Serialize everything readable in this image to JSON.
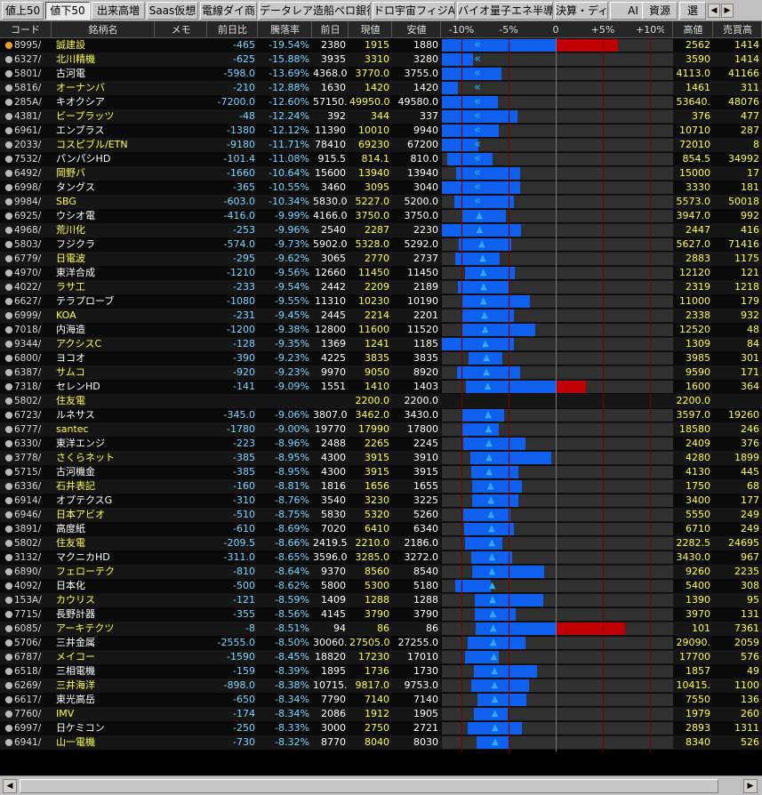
{
  "tabs": [
    "値上50",
    "値下50",
    "出来高増",
    "Saas仮想",
    "電線ダイ商",
    "データレア造船ペロ銀行",
    "ドロ宇宙フィジAI",
    "バイオ量子エネ半導",
    "決算・ディ",
    "AI",
    "資源",
    "選"
  ],
  "active_tab": 1,
  "columns": [
    "コード",
    "銘柄名",
    "メモ",
    "前日比",
    "騰落率",
    "前日",
    "現値",
    "安値",
    "",
    "高値",
    "売買高"
  ],
  "chart_ticks": [
    "-10%",
    "-5%",
    "0",
    "+5%",
    "+10%"
  ],
  "colors": {
    "bar_negative": "#1060f0",
    "bar_positive": "#c00000",
    "name_yellow": "#ffff40",
    "code_color": "#d8d8d8",
    "triangle": "#2ab0ff"
  },
  "rows": [
    {
      "code": "8995/",
      "name": "誠建設",
      "yellow": true,
      "chg": "-465",
      "pct": "-19.54%",
      "prev": "2380",
      "price": "1915",
      "low": "1880",
      "high": "2562",
      "vol": "1414",
      "pct_val": -19.54,
      "vs_low": -21.0,
      "vs_high": 6.6,
      "marker": "double-chevron"
    },
    {
      "code": "6327/",
      "name": "北川精機",
      "yellow": true,
      "chg": "-625",
      "pct": "-15.88%",
      "prev": "3935",
      "price": "3310",
      "low": "3280",
      "high": "3590",
      "vol": "1414",
      "pct_val": -15.88,
      "vs_low": -16.6,
      "vs_high": -8.8,
      "marker": "double-chevron"
    },
    {
      "code": "5801/",
      "name": "古河電",
      "yellow": false,
      "chg": "-598.0",
      "pct": "-13.69%",
      "prev": "4368.0",
      "price": "3770.0",
      "low": "3755.0",
      "high": "4113.0",
      "vol": "41166",
      "pct_val": -13.69,
      "vs_low": -14.0,
      "vs_high": -5.8,
      "marker": "double-chevron"
    },
    {
      "code": "5816/",
      "name": "オーナンバ",
      "yellow": true,
      "chg": "-210",
      "pct": "-12.88%",
      "prev": "1630",
      "price": "1420",
      "low": "1420",
      "high": "1461",
      "vol": "311",
      "pct_val": -12.88,
      "vs_low": -12.9,
      "vs_high": -10.4,
      "marker": "double-chevron"
    },
    {
      "code": "285A/",
      "name": "キオクシア",
      "yellow": false,
      "chg": "-7200.0",
      "pct": "-12.60%",
      "prev": "57150.",
      "price": "49950.0",
      "low": "49580.0",
      "high": "53640.",
      "vol": "48076",
      "pct_val": -12.6,
      "vs_low": -13.2,
      "vs_high": -6.1,
      "marker": "double-chevron"
    },
    {
      "code": "4381/",
      "name": "ビープラッツ",
      "yellow": true,
      "chg": "-48",
      "pct": "-12.24%",
      "prev": "392",
      "price": "344",
      "low": "337",
      "high": "376",
      "vol": "477",
      "pct_val": -12.24,
      "vs_low": -14.0,
      "vs_high": -4.1,
      "marker": "double-chevron"
    },
    {
      "code": "6961/",
      "name": "エンプラス",
      "yellow": false,
      "chg": "-1380",
      "pct": "-12.12%",
      "prev": "11390",
      "price": "10010",
      "low": "9940",
      "high": "10710",
      "vol": "287",
      "pct_val": -12.12,
      "vs_low": -12.7,
      "vs_high": -6.0,
      "marker": "double-chevron"
    },
    {
      "code": "2033/",
      "name": "コスピブル/ETN",
      "yellow": true,
      "chg": "-9180",
      "pct": "-11.71%",
      "prev": "78410",
      "price": "69230",
      "low": "67200",
      "high": "72010",
      "vol": "8",
      "pct_val": -11.71,
      "vs_low": -14.3,
      "vs_high": -8.2,
      "marker": "double-chevron"
    },
    {
      "code": "7532/",
      "name": "パンパシHD",
      "yellow": false,
      "chg": "-101.4",
      "pct": "-11.08%",
      "prev": "915.5",
      "price": "814.1",
      "low": "810.0",
      "high": "854.5",
      "vol": "34992",
      "pct_val": -11.08,
      "vs_low": -11.5,
      "vs_high": -6.7,
      "marker": "double-chevron"
    },
    {
      "code": "6492/",
      "name": "岡野バ",
      "yellow": true,
      "chg": "-1660",
      "pct": "-10.64%",
      "prev": "15600",
      "price": "13940",
      "low": "13940",
      "high": "15000",
      "vol": "17",
      "pct_val": -10.64,
      "vs_low": -10.6,
      "vs_high": -3.8,
      "marker": "double-chevron"
    },
    {
      "code": "6998/",
      "name": "タングス",
      "yellow": false,
      "chg": "-365",
      "pct": "-10.55%",
      "prev": "3460",
      "price": "3095",
      "low": "3040",
      "high": "3330",
      "vol": "181",
      "pct_val": -10.55,
      "vs_low": -12.1,
      "vs_high": -3.8,
      "marker": "double-chevron"
    },
    {
      "code": "9984/",
      "name": "SBG",
      "yellow": true,
      "chg": "-603.0",
      "pct": "-10.34%",
      "prev": "5830.0",
      "price": "5227.0",
      "low": "5200.0",
      "high": "5573.0",
      "vol": "50018",
      "pct_val": -10.34,
      "vs_low": -10.8,
      "vs_high": -4.4,
      "marker": "double-chevron"
    },
    {
      "code": "6925/",
      "name": "ウシオ電",
      "yellow": false,
      "chg": "-416.0",
      "pct": "-9.99%",
      "prev": "4166.0",
      "price": "3750.0",
      "low": "3750.0",
      "high": "3947.0",
      "vol": "992",
      "pct_val": -9.99,
      "vs_low": -10.0,
      "vs_high": -5.3,
      "marker": "triangle"
    },
    {
      "code": "4968/",
      "name": "荒川化",
      "yellow": true,
      "chg": "-253",
      "pct": "-9.96%",
      "prev": "2540",
      "price": "2287",
      "low": "2230",
      "high": "2447",
      "vol": "416",
      "pct_val": -9.96,
      "vs_low": -12.2,
      "vs_high": -3.7,
      "marker": "triangle"
    },
    {
      "code": "5803/",
      "name": "フジクラ",
      "yellow": false,
      "chg": "-574.0",
      "pct": "-9.73%",
      "prev": "5902.0",
      "price": "5328.0",
      "low": "5292.0",
      "high": "5627.0",
      "vol": "71416",
      "pct_val": -9.73,
      "vs_low": -10.3,
      "vs_high": -4.7,
      "marker": "triangle"
    },
    {
      "code": "6779/",
      "name": "日電波",
      "yellow": true,
      "chg": "-295",
      "pct": "-9.62%",
      "prev": "3065",
      "price": "2770",
      "low": "2737",
      "high": "2883",
      "vol": "1175",
      "pct_val": -9.62,
      "vs_low": -10.7,
      "vs_high": -5.9,
      "marker": "triangle"
    },
    {
      "code": "4970/",
      "name": "東洋合成",
      "yellow": false,
      "chg": "-1210",
      "pct": "-9.56%",
      "prev": "12660",
      "price": "11450",
      "low": "11450",
      "high": "12120",
      "vol": "121",
      "pct_val": -9.56,
      "vs_low": -9.6,
      "vs_high": -4.3,
      "marker": "triangle"
    },
    {
      "code": "4022/",
      "name": "ラサ工",
      "yellow": true,
      "chg": "-233",
      "pct": "-9.54%",
      "prev": "2442",
      "price": "2209",
      "low": "2189",
      "high": "2319",
      "vol": "1218",
      "pct_val": -9.54,
      "vs_low": -10.4,
      "vs_high": -5.0,
      "marker": "triangle"
    },
    {
      "code": "6627/",
      "name": "テラプローブ",
      "yellow": false,
      "chg": "-1080",
      "pct": "-9.55%",
      "prev": "11310",
      "price": "10230",
      "low": "10190",
      "high": "11000",
      "vol": "179",
      "pct_val": -9.55,
      "vs_low": -9.9,
      "vs_high": -2.7,
      "marker": "triangle"
    },
    {
      "code": "6999/",
      "name": "KOA",
      "yellow": true,
      "chg": "-231",
      "pct": "-9.45%",
      "prev": "2445",
      "price": "2214",
      "low": "2201",
      "high": "2338",
      "vol": "932",
      "pct_val": -9.45,
      "vs_low": -10.0,
      "vs_high": -4.4,
      "marker": "triangle"
    },
    {
      "code": "7018/",
      "name": "内海造",
      "yellow": false,
      "chg": "-1200",
      "pct": "-9.38%",
      "prev": "12800",
      "price": "11600",
      "low": "11520",
      "high": "12520",
      "vol": "48",
      "pct_val": -9.38,
      "vs_low": -10.0,
      "vs_high": -2.2,
      "marker": "triangle"
    },
    {
      "code": "9344/",
      "name": "アクシスC",
      "yellow": true,
      "chg": "-128",
      "pct": "-9.35%",
      "prev": "1369",
      "price": "1241",
      "low": "1185",
      "high": "1309",
      "vol": "84",
      "pct_val": -9.35,
      "vs_low": -13.4,
      "vs_high": -4.4,
      "marker": "triangle"
    },
    {
      "code": "6800/",
      "name": "ヨコオ",
      "yellow": false,
      "chg": "-390",
      "pct": "-9.23%",
      "prev": "4225",
      "price": "3835",
      "low": "3835",
      "high": "3985",
      "vol": "301",
      "pct_val": -9.23,
      "vs_low": -9.2,
      "vs_high": -5.7,
      "marker": "triangle"
    },
    {
      "code": "6387/",
      "name": "サムコ",
      "yellow": true,
      "chg": "-920",
      "pct": "-9.23%",
      "prev": "9970",
      "price": "9050",
      "low": "8920",
      "high": "9590",
      "vol": "171",
      "pct_val": -9.23,
      "vs_low": -10.5,
      "vs_high": -3.8,
      "marker": "triangle"
    },
    {
      "code": "7318/",
      "name": "セレンHD",
      "yellow": false,
      "chg": "-141",
      "pct": "-9.09%",
      "prev": "1551",
      "price": "1410",
      "low": "1403",
      "high": "1600",
      "vol": "364",
      "pct_val": -9.09,
      "vs_low": -9.5,
      "vs_high": 3.2,
      "marker": "triangle"
    },
    {
      "code": "5802/",
      "name": "住友電",
      "yellow": true,
      "chg": "",
      "pct": "",
      "prev": "",
      "price": "2200.0",
      "low": "2200.0",
      "high": "2200.0",
      "vol": "",
      "pct_val": null,
      "vs_low": null,
      "vs_high": null,
      "marker": "none"
    },
    {
      "code": "6723/",
      "name": "ルネサス",
      "yellow": false,
      "chg": "-345.0",
      "pct": "-9.06%",
      "prev": "3807.0",
      "price": "3462.0",
      "low": "3430.0",
      "high": "3597.0",
      "vol": "19260",
      "pct_val": -9.06,
      "vs_low": -9.9,
      "vs_high": -5.5,
      "marker": "triangle"
    },
    {
      "code": "6777/",
      "name": "santec",
      "yellow": true,
      "chg": "-1780",
      "pct": "-9.00%",
      "prev": "19770",
      "price": "17990",
      "low": "17800",
      "high": "18580",
      "vol": "246",
      "pct_val": -9.0,
      "vs_low": -10.0,
      "vs_high": -6.0,
      "marker": "triangle"
    },
    {
      "code": "6330/",
      "name": "東洋エンジ",
      "yellow": false,
      "chg": "-223",
      "pct": "-8.96%",
      "prev": "2488",
      "price": "2265",
      "low": "2245",
      "high": "2409",
      "vol": "376",
      "pct_val": -8.96,
      "vs_low": -9.8,
      "vs_high": -3.2,
      "marker": "triangle"
    },
    {
      "code": "3778/",
      "name": "さくらネット",
      "yellow": true,
      "chg": "-385",
      "pct": "-8.95%",
      "prev": "4300",
      "price": "3915",
      "low": "3910",
      "high": "4280",
      "vol": "1899",
      "pct_val": -8.95,
      "vs_low": -9.1,
      "vs_high": -0.5,
      "marker": "triangle"
    },
    {
      "code": "5715/",
      "name": "古河機金",
      "yellow": false,
      "chg": "-385",
      "pct": "-8.95%",
      "prev": "4300",
      "price": "3915",
      "low": "3915",
      "high": "4130",
      "vol": "445",
      "pct_val": -8.95,
      "vs_low": -9.0,
      "vs_high": -4.0,
      "marker": "triangle"
    },
    {
      "code": "6336/",
      "name": "石井表記",
      "yellow": true,
      "chg": "-160",
      "pct": "-8.81%",
      "prev": "1816",
      "price": "1656",
      "low": "1655",
      "high": "1750",
      "vol": "68",
      "pct_val": -8.81,
      "vs_low": -8.9,
      "vs_high": -3.6,
      "marker": "triangle"
    },
    {
      "code": "6914/",
      "name": "オプテクスG",
      "yellow": false,
      "chg": "-310",
      "pct": "-8.76%",
      "prev": "3540",
      "price": "3230",
      "low": "3225",
      "high": "3400",
      "vol": "177",
      "pct_val": -8.76,
      "vs_low": -8.9,
      "vs_high": -4.0,
      "marker": "triangle"
    },
    {
      "code": "6946/",
      "name": "日本アビオ",
      "yellow": true,
      "chg": "-510",
      "pct": "-8.75%",
      "prev": "5830",
      "price": "5320",
      "low": "5260",
      "high": "5550",
      "vol": "249",
      "pct_val": -8.75,
      "vs_low": -9.8,
      "vs_high": -4.8,
      "marker": "triangle"
    },
    {
      "code": "3891/",
      "name": "高度紙",
      "yellow": false,
      "chg": "-610",
      "pct": "-8.69%",
      "prev": "7020",
      "price": "6410",
      "low": "6340",
      "high": "6710",
      "vol": "249",
      "pct_val": -8.69,
      "vs_low": -9.7,
      "vs_high": -4.4,
      "marker": "triangle"
    },
    {
      "code": "5802/",
      "name": "住友電",
      "yellow": true,
      "chg": "-209.5",
      "pct": "-8.66%",
      "prev": "2419.5",
      "price": "2210.0",
      "low": "2186.0",
      "high": "2282.5",
      "vol": "24695",
      "pct_val": -8.66,
      "vs_low": -9.6,
      "vs_high": -5.7,
      "marker": "triangle"
    },
    {
      "code": "3132/",
      "name": "マクニカHD",
      "yellow": false,
      "chg": "-311.0",
      "pct": "-8.65%",
      "prev": "3596.0",
      "price": "3285.0",
      "low": "3272.0",
      "high": "3430.0",
      "vol": "967",
      "pct_val": -8.65,
      "vs_low": -9.0,
      "vs_high": -4.6,
      "marker": "triangle"
    },
    {
      "code": "6890/",
      "name": "フェローテク",
      "yellow": true,
      "chg": "-810",
      "pct": "-8.64%",
      "prev": "9370",
      "price": "8560",
      "low": "8540",
      "high": "9260",
      "vol": "2235",
      "pct_val": -8.64,
      "vs_low": -8.9,
      "vs_high": -1.2,
      "marker": "triangle"
    },
    {
      "code": "4092/",
      "name": "日本化",
      "yellow": false,
      "chg": "-500",
      "pct": "-8.62%",
      "prev": "5800",
      "price": "5300",
      "low": "5180",
      "high": "5400",
      "vol": "308",
      "pct_val": -8.62,
      "vs_low": -10.7,
      "vs_high": -6.9,
      "marker": "triangle"
    },
    {
      "code": "153A/",
      "name": "カウリス",
      "yellow": true,
      "chg": "-121",
      "pct": "-8.59%",
      "prev": "1409",
      "price": "1288",
      "low": "1288",
      "high": "1390",
      "vol": "95",
      "pct_val": -8.59,
      "vs_low": -8.6,
      "vs_high": -1.3,
      "marker": "triangle"
    },
    {
      "code": "7715/",
      "name": "長野計器",
      "yellow": false,
      "chg": "-355",
      "pct": "-8.56%",
      "prev": "4145",
      "price": "3790",
      "low": "3790",
      "high": "3970",
      "vol": "131",
      "pct_val": -8.56,
      "vs_low": -8.6,
      "vs_high": -4.2,
      "marker": "triangle"
    },
    {
      "code": "6085/",
      "name": "アーキテクツ",
      "yellow": true,
      "chg": "-8",
      "pct": "-8.51%",
      "prev": "94",
      "price": "86",
      "low": "86",
      "high": "101",
      "vol": "7361",
      "pct_val": -8.51,
      "vs_low": -8.5,
      "vs_high": 7.4,
      "marker": "triangle"
    },
    {
      "code": "5706/",
      "name": "三井金属",
      "yellow": false,
      "chg": "-2555.0",
      "pct": "-8.50%",
      "prev": "30060.",
      "price": "27505.0",
      "low": "27255.0",
      "high": "29090.",
      "vol": "2059",
      "pct_val": -8.5,
      "vs_low": -9.3,
      "vs_high": -3.2,
      "marker": "triangle"
    },
    {
      "code": "6787/",
      "name": "メイコー",
      "yellow": true,
      "chg": "-1590",
      "pct": "-8.45%",
      "prev": "18820",
      "price": "17230",
      "low": "17010",
      "high": "17700",
      "vol": "576",
      "pct_val": -8.45,
      "vs_low": -9.6,
      "vs_high": -6.0,
      "marker": "triangle"
    },
    {
      "code": "6518/",
      "name": "三相電機",
      "yellow": false,
      "chg": "-159",
      "pct": "-8.39%",
      "prev": "1895",
      "price": "1736",
      "low": "1730",
      "high": "1857",
      "vol": "49",
      "pct_val": -8.39,
      "vs_low": -8.7,
      "vs_high": -2.0,
      "marker": "triangle"
    },
    {
      "code": "6269/",
      "name": "三井海洋",
      "yellow": true,
      "chg": "-898.0",
      "pct": "-8.38%",
      "prev": "10715.",
      "price": "9817.0",
      "low": "9753.0",
      "high": "10415.",
      "vol": "1100",
      "pct_val": -8.38,
      "vs_low": -9.0,
      "vs_high": -2.8,
      "marker": "triangle"
    },
    {
      "code": "6617/",
      "name": "東光高岳",
      "yellow": false,
      "chg": "-650",
      "pct": "-8.34%",
      "prev": "7790",
      "price": "7140",
      "low": "7140",
      "high": "7550",
      "vol": "136",
      "pct_val": -8.34,
      "vs_low": -8.3,
      "vs_high": -3.1,
      "marker": "triangle"
    },
    {
      "code": "7760/",
      "name": "IMV",
      "yellow": true,
      "chg": "-174",
      "pct": "-8.34%",
      "prev": "2086",
      "price": "1912",
      "low": "1905",
      "high": "1979",
      "vol": "260",
      "pct_val": -8.34,
      "vs_low": -8.7,
      "vs_high": -5.1,
      "marker": "triangle"
    },
    {
      "code": "6997/",
      "name": "日ケミコン",
      "yellow": false,
      "chg": "-250",
      "pct": "-8.33%",
      "prev": "3000",
      "price": "2750",
      "low": "2721",
      "high": "2893",
      "vol": "1311",
      "pct_val": -8.33,
      "vs_low": -9.3,
      "vs_high": -3.6,
      "marker": "triangle"
    },
    {
      "code": "6941/",
      "name": "山一電機",
      "yellow": true,
      "chg": "-730",
      "pct": "-8.32%",
      "prev": "8770",
      "price": "8040",
      "low": "8030",
      "high": "8340",
      "vol": "526",
      "pct_val": -8.32,
      "vs_low": -8.4,
      "vs_high": -4.9,
      "marker": "triangle"
    }
  ]
}
